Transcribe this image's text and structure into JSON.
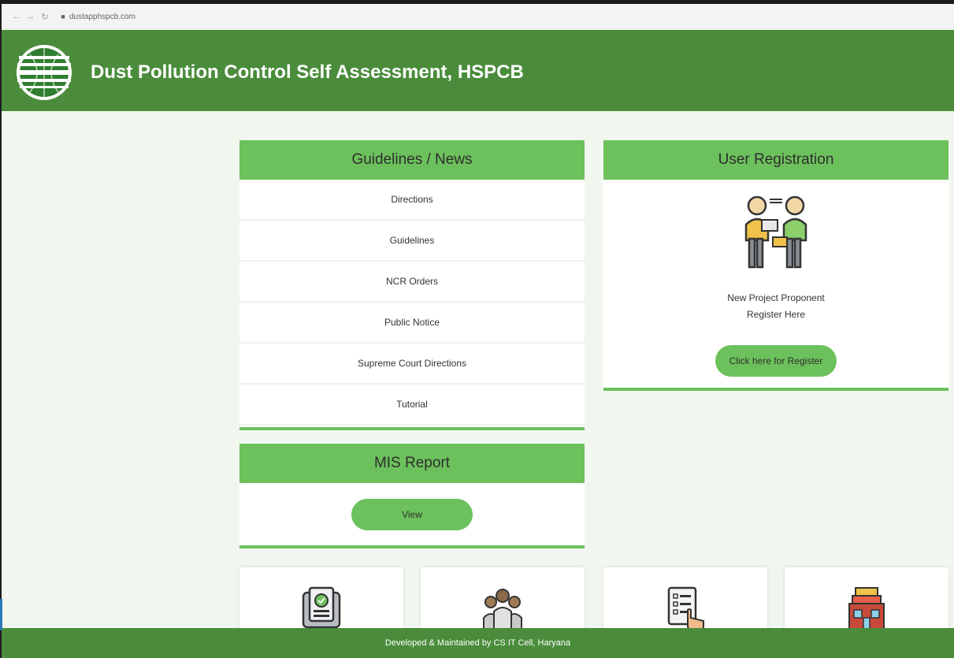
{
  "browser": {
    "url": "dustapphspcb.com"
  },
  "header": {
    "title": "Dust Pollution Control Self Assessment, HSPCB"
  },
  "guidelines": {
    "heading": "Guidelines / News",
    "items": [
      "Directions",
      "Guidelines",
      "NCR Orders",
      "Public Notice",
      "Supreme Court Directions",
      "Tutorial"
    ]
  },
  "registration": {
    "heading": "User Registration",
    "line1": "New Project Proponent",
    "line2": "Register Here",
    "button_label": "Click here for Register"
  },
  "mis": {
    "heading": "MIS Report",
    "button_label": "View"
  },
  "cards": [
    {
      "icon": "tablet-check-icon"
    },
    {
      "icon": "group-people-icon"
    },
    {
      "icon": "checklist-hand-icon"
    },
    {
      "icon": "building-icon"
    }
  ],
  "footer": {
    "text": "Developed & Maintained by CS IT Cell, Haryana"
  },
  "colors": {
    "header": "#4a8c3b",
    "accent": "#6cc15c",
    "background": "#f1f7ef"
  }
}
